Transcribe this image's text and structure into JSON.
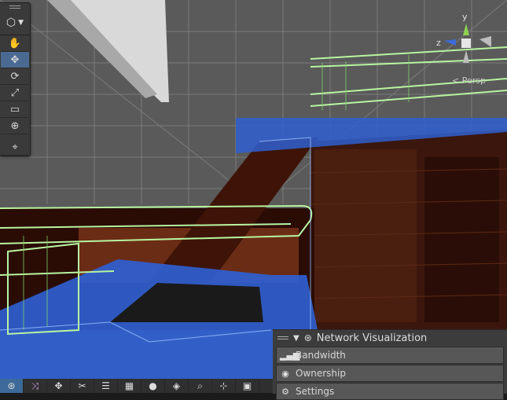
{
  "scene": {
    "description_icons": [
      "scene-grid",
      "wireframe-mesh"
    ]
  },
  "tool_palette": {
    "mode_icon": "cube-icon",
    "tools": [
      {
        "name": "hand-tool",
        "glyph": "✋",
        "active": false
      },
      {
        "name": "move-tool",
        "glyph": "✥",
        "active": true
      },
      {
        "name": "rotate-tool",
        "glyph": "⟳",
        "active": false
      },
      {
        "name": "scale-tool",
        "glyph": "⤢",
        "active": false
      },
      {
        "name": "rect-tool",
        "glyph": "▭",
        "active": false
      },
      {
        "name": "transform-tool",
        "glyph": "⊕",
        "active": false
      },
      {
        "name": "custom-tool",
        "glyph": "⌖",
        "active": false
      }
    ]
  },
  "gizmo": {
    "y_axis": "y",
    "z_axis": "z",
    "projection": "< Persp"
  },
  "network_visualization": {
    "title": "Network Visualization",
    "items": [
      {
        "label": "Bandwidth",
        "icon": "bar-chart-icon"
      },
      {
        "label": "Ownership",
        "icon": "user-circle-icon"
      },
      {
        "label": "Settings",
        "icon": "gear-icon"
      }
    ]
  },
  "bottom_toolbar": {
    "buttons": [
      "network-icon",
      "shuffle-icon",
      "move-icon",
      "scissors-icon",
      "layers-icon",
      "grid-icon",
      "circle-icon",
      "diamond-icon",
      "search-icon",
      "hierarchy-icon",
      "window-icon"
    ]
  },
  "colors": {
    "wire_green": "#b8f5a0",
    "wire_blue": "#2f5fd0",
    "active_tool": "#4a6a92",
    "wall": "#3b160c"
  }
}
